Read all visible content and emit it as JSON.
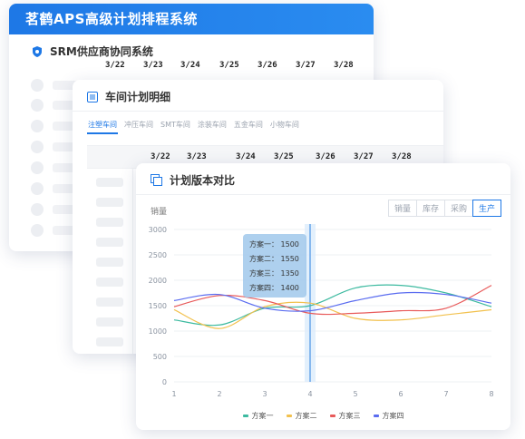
{
  "aps": {
    "title": "茗鹤APS高级计划排程系统",
    "srm_title": "SRM供应商协同系统",
    "dates": [
      "3/22",
      "3/23",
      "3/24",
      "3/25",
      "3/26",
      "3/27",
      "3/28"
    ]
  },
  "workshop": {
    "title": "车间计划明细",
    "tabs": [
      "注塑车间",
      "冲压车间",
      "SMT车间",
      "涂装车间",
      "五金车间",
      "小物车间"
    ],
    "dates": [
      "3/22",
      "3/23",
      "3/24",
      "3/25",
      "3/26",
      "3/27",
      "3/28"
    ]
  },
  "chart_card": {
    "title": "计划版本对比",
    "ylabel": "销量",
    "metric_tabs": [
      "销量",
      "库存",
      "采购",
      "生产"
    ],
    "active_tab": "生产",
    "tooltip": {
      "rows": [
        "方案一：  1500",
        "方案二：  1550",
        "方案三：  1350",
        "方案四：  1400"
      ]
    }
  },
  "chart_data": {
    "type": "line",
    "title": "计划版本对比",
    "xlabel": "",
    "ylabel": "销量",
    "x": [
      1,
      2,
      3,
      4,
      5,
      6,
      7,
      8
    ],
    "ylim": [
      0,
      3000
    ],
    "yticks": [
      0,
      500,
      1000,
      1500,
      2000,
      2500,
      3000
    ],
    "grid": true,
    "legend_position": "bottom",
    "highlight_x": 4,
    "series": [
      {
        "name": "方案一",
        "color": "#3dbaa0",
        "values": [
          1220,
          1120,
          1450,
          1500,
          1850,
          1900,
          1750,
          1480
        ]
      },
      {
        "name": "方案二",
        "color": "#f2c14e",
        "values": [
          1420,
          1050,
          1480,
          1550,
          1250,
          1220,
          1320,
          1420
        ]
      },
      {
        "name": "方案三",
        "color": "#e85a5a",
        "values": [
          1480,
          1700,
          1600,
          1350,
          1350,
          1400,
          1450,
          1900
        ]
      },
      {
        "name": "方案四",
        "color": "#5a6cf0",
        "values": [
          1600,
          1720,
          1450,
          1400,
          1600,
          1750,
          1720,
          1550
        ]
      }
    ]
  }
}
